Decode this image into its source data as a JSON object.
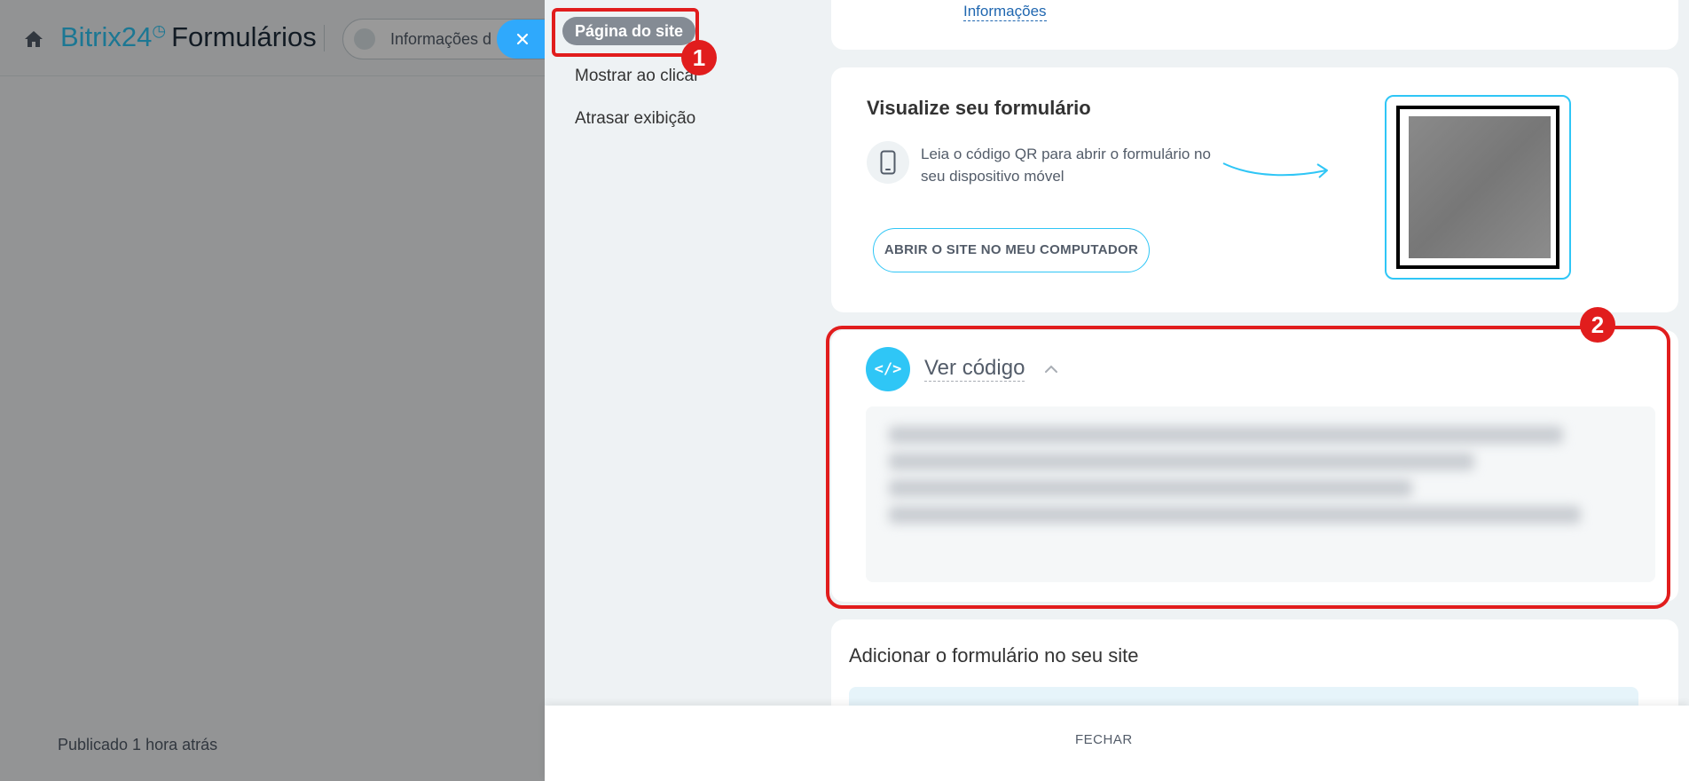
{
  "background_app": {
    "brand_name": "Bitrix24",
    "brand_clock": "◷",
    "page_title": "Formulários",
    "form_pill_text": "Informações d",
    "status": "Publicado 1 hora atrás"
  },
  "slider": {
    "nav": {
      "active_item": "Página do site",
      "items": [
        "Mostrar ao clicar",
        "Atrasar exibição"
      ]
    },
    "top_card": {
      "link": "Informações"
    },
    "preview_card": {
      "title": "Visualize seu formulário",
      "qr_text": "Leia o código QR para abrir o formulário no seu dispositivo móvel",
      "open_button": "ABRIR O SITE NO MEU COMPUTADOR"
    },
    "code_card": {
      "icon_label": "</>",
      "title": "Ver código"
    },
    "add_card": {
      "title": "Adicionar o formulário no seu site"
    },
    "footer": {
      "close_button": "FECHAR"
    }
  },
  "annotations": {
    "marker_1": "1",
    "marker_2": "2",
    "color": "#e11d1d"
  },
  "colors": {
    "accent": "#2fc6f6",
    "link": "#2067b0",
    "close_tab": "#2fa9fc"
  }
}
